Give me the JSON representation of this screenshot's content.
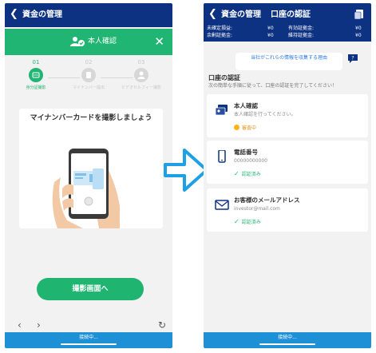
{
  "left_screen": {
    "nav": {
      "back_icon": "chevron-left-icon",
      "title": "資金の管理"
    },
    "header": {
      "icon": "person-check-icon",
      "title": "本人確認",
      "close_icon": "close-icon"
    },
    "steps": [
      {
        "number": "01",
        "label": "身分証撮影",
        "icon": "id-card-icon",
        "active": true
      },
      {
        "number": "02",
        "label": "マイナンバー提出",
        "icon": "document-icon",
        "active": false
      },
      {
        "number": "03",
        "label": "ビデオセルフィー撮影",
        "icon": "person-icon",
        "active": false
      }
    ],
    "card_title": "マイナンバーカードを撮影しましょう",
    "card_illustration": "hand-holding-phone-illustration",
    "button": "撮影画面へ",
    "browser": {
      "back_icon": "chevron-left-icon",
      "forward_icon": "chevron-right-icon",
      "reload_icon": "reload-icon"
    },
    "status": "接続中..."
  },
  "arrow_icon": "arrow-right-icon",
  "right_screen": {
    "nav": {
      "back_icon": "chevron-left-icon",
      "title": "資金の管理",
      "page_title": "口座の認証",
      "doc_icon": "document-icon"
    },
    "balances": [
      {
        "label": "未確定損益:",
        "value": "¥0"
      },
      {
        "label": "余剰証拠金:",
        "value": "¥0"
      },
      {
        "label": "有効証拠金:",
        "value": "¥0"
      },
      {
        "label": "維持証拠金:",
        "value": "¥0"
      }
    ],
    "reason_text": "当社がこれらの情報を収集する理由",
    "chat_icon": "chat-question-icon",
    "section_title": "口座の認証",
    "section_desc": "次の簡単な手順に従って、口座の認証を完了してください！",
    "verifications": [
      {
        "icon": "id-cards-icon",
        "title": "本人確認",
        "subtitle": "本人確認を行ってください。",
        "status": "審査中",
        "status_type": "pending"
      },
      {
        "icon": "smartphone-icon",
        "title": "電話番号",
        "subtitle": "00000000000",
        "status": "認証済み",
        "status_type": "verified"
      },
      {
        "icon": "envelope-icon",
        "title": "お客様のメールアドレス",
        "subtitle": "investor@mail.com",
        "status": "認証済み",
        "status_type": "verified"
      }
    ],
    "status": "接続中..."
  },
  "colors": {
    "navy": "#0d3282",
    "green": "#21b573",
    "blue": "#1e90d6",
    "amber": "#ffb11a"
  }
}
